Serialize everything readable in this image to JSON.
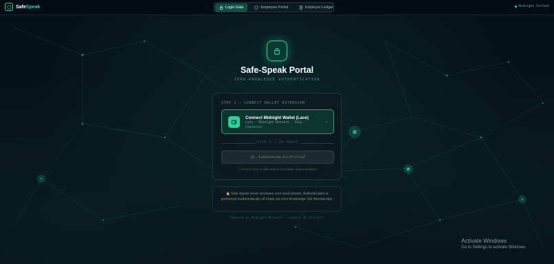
{
  "brand": {
    "name_part1": "Safe",
    "name_part2": "Speak"
  },
  "nav": {
    "tabs": [
      {
        "label": "Login Gate",
        "icon": "lock-icon",
        "active": true
      },
      {
        "label": "Employee Portal",
        "icon": "shield-icon",
        "active": false
      },
      {
        "label": "Employer Ledger",
        "icon": "document-icon",
        "active": false
      }
    ]
  },
  "network": {
    "label": "Midnight Testnet"
  },
  "hero": {
    "title": "Safe-Speak Portal",
    "subtitle": "ZERO-KNOWLEDGE AUTHENTICATION"
  },
  "card": {
    "step1_label": "STEP 1 — CONNECT WALLET EXTENSION",
    "wallet_title": "Connect Midnight Wallet (Lace)",
    "wallet_subtitle": "Lace · Midnight Network · Shqs Connector",
    "step2_label": "STEP 2 — ZK-PROOF",
    "zk_button": "Authenticate via ZK-Proof",
    "hint": "Connect your wallet above to enable authentication"
  },
  "notice": {
    "text": "Safe-Speak never accesses your seed phrase. Authentication is performed mathematically off-chain via Zero-Knowledge Set Membership."
  },
  "footer": {
    "text": "Powered by Midnight Network · Compact ZK Circuits"
  },
  "os_overlay": {
    "title": "Activate Windows",
    "subtitle": "Go to Settings to activate Windows."
  },
  "colors": {
    "accent": "#2fd19a",
    "background": "#06121a",
    "card": "#0e1a20"
  }
}
